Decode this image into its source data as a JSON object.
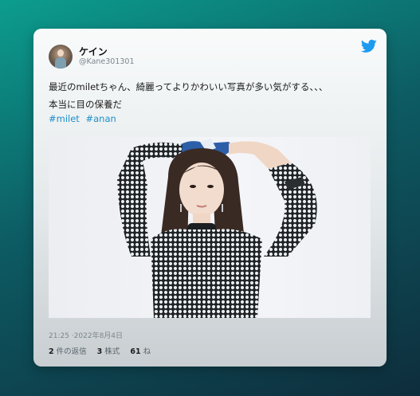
{
  "tweet": {
    "display_name": "ケイン",
    "handle": "@Kane301301",
    "text": "最近のmiletちゃん、綺麗ってよりかわいい写真が多い気がする、、、\n本当に目の保養だ",
    "hashtags": [
      "#milet",
      "#anan"
    ],
    "timestamp": "21:25 ·2022年8月4日",
    "stats": {
      "replies_count": "2",
      "replies_label": "件の返信",
      "retweets_count": "3",
      "retweets_label": "株式",
      "likes_count": "61",
      "likes_label": "ね"
    }
  },
  "icons": {
    "brand": "twitter-bird-icon",
    "avatar": "user-avatar"
  },
  "colors": {
    "twitter_blue": "#1d9bf0",
    "hashtag": "#1d8ec9"
  }
}
